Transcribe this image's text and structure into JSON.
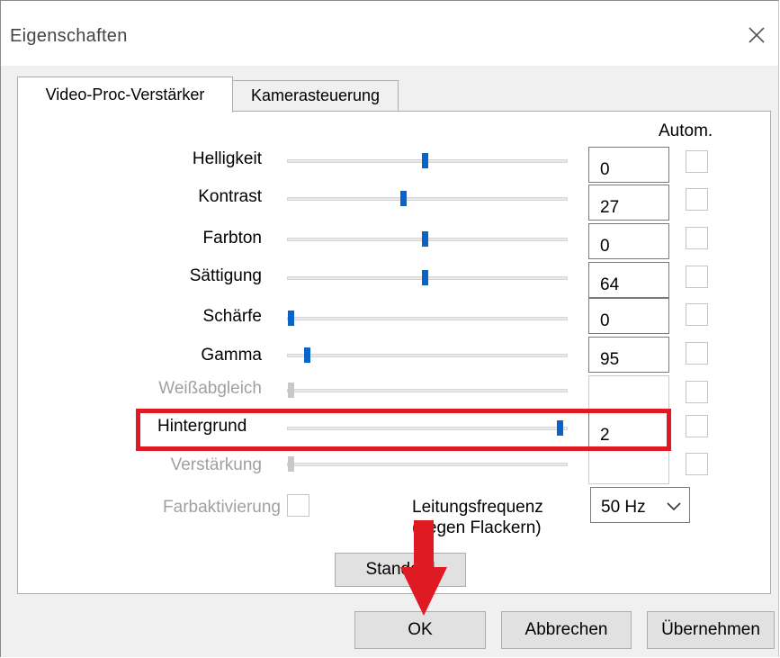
{
  "window": {
    "title": "Eigenschaften"
  },
  "tabs": [
    {
      "label": "Video-Proc-Verstärker",
      "active": true
    },
    {
      "label": "Kamerasteuerung",
      "active": false
    }
  ],
  "auto_header": "Autom.",
  "rows": [
    {
      "label": "Helligkeit",
      "value": "0",
      "slider_fraction": 0.49,
      "enabled": true
    },
    {
      "label": "Kontrast",
      "value": "27",
      "slider_fraction": 0.41,
      "enabled": true
    },
    {
      "label": "Farbton",
      "value": "0",
      "slider_fraction": 0.49,
      "enabled": true
    },
    {
      "label": "Sättigung",
      "value": "64",
      "slider_fraction": 0.49,
      "enabled": true
    },
    {
      "label": "Schärfe",
      "value": "0",
      "slider_fraction": 0.0,
      "enabled": true
    },
    {
      "label": "Gamma",
      "value": "95",
      "slider_fraction": 0.06,
      "enabled": true
    },
    {
      "label": "Weißabgleich",
      "value": "",
      "slider_fraction": 0.0,
      "enabled": false
    },
    {
      "label": "Hintergrund",
      "value": "2",
      "slider_fraction": 0.98,
      "enabled": true,
      "highlighted": true
    },
    {
      "label": "Verstärkung",
      "value": "",
      "slider_fraction": 0.0,
      "enabled": false
    }
  ],
  "color_enable": {
    "label": "Farbaktivierung"
  },
  "line_frequency": {
    "label_line1": "Leitungsfrequenz",
    "label_line2": "(gegen Flackern)",
    "selected": "50 Hz"
  },
  "buttons": {
    "default": "Standard",
    "ok": "OK",
    "cancel": "Abbrechen",
    "apply": "Übernehmen"
  },
  "colors": {
    "accent": "#0a64c8",
    "highlight": "#e01a22"
  },
  "icons": {
    "close": "close-icon",
    "dropdown": "chevron-down-icon",
    "annotation_arrow": "arrow-down-icon"
  }
}
